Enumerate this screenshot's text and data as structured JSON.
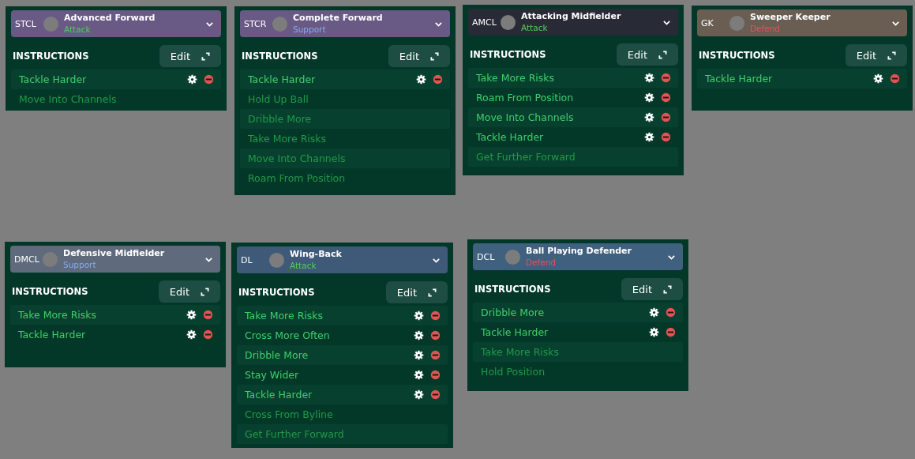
{
  "cards": [
    {
      "position": "STCL",
      "role": "Advanced Forward",
      "duty": {
        "text": "Attack",
        "kind": "attack"
      },
      "color": "#695985",
      "section_title": "INSTRUCTIONS",
      "edit_label": "Edit",
      "instructions": [
        {
          "label": "Tackle Harder",
          "active": true
        },
        {
          "label": "Move Into Channels",
          "active": false
        }
      ]
    },
    {
      "position": "STCR",
      "role": "Complete Forward",
      "duty": {
        "text": "Support",
        "kind": "support"
      },
      "color": "#695985",
      "section_title": "INSTRUCTIONS",
      "edit_label": "Edit",
      "instructions": [
        {
          "label": "Tackle Harder",
          "active": true
        },
        {
          "label": "Hold Up Ball",
          "active": false
        },
        {
          "label": "Dribble More",
          "active": false
        },
        {
          "label": "Take More Risks",
          "active": false
        },
        {
          "label": "Move Into Channels",
          "active": false
        },
        {
          "label": "Roam From Position",
          "active": false
        }
      ]
    },
    {
      "position": "AMCL",
      "role": "Attacking Midfielder",
      "duty": {
        "text": "Attack",
        "kind": "attack"
      },
      "color": "#282b35",
      "section_title": "INSTRUCTIONS",
      "edit_label": "Edit",
      "instructions": [
        {
          "label": "Take More Risks",
          "active": true
        },
        {
          "label": "Roam From Position",
          "active": true
        },
        {
          "label": "Move Into Channels",
          "active": true
        },
        {
          "label": "Tackle Harder",
          "active": true
        },
        {
          "label": "Get Further Forward",
          "active": false
        }
      ]
    },
    {
      "position": "GK",
      "role": "Sweeper Keeper",
      "duty": {
        "text": "Defend",
        "kind": "defend"
      },
      "color": "#6a5e53",
      "section_title": "INSTRUCTIONS",
      "edit_label": "Edit",
      "instructions": [
        {
          "label": "Tackle Harder",
          "active": true
        }
      ]
    },
    {
      "position": "DMCL",
      "role": "Defensive Midfielder",
      "duty": {
        "text": "Support",
        "kind": "support"
      },
      "color": "#5f6b7c",
      "section_title": "INSTRUCTIONS",
      "edit_label": "Edit",
      "instructions": [
        {
          "label": "Take More Risks",
          "active": true
        },
        {
          "label": "Tackle Harder",
          "active": true
        }
      ]
    },
    {
      "position": "DL",
      "role": "Wing-Back",
      "duty": {
        "text": "Attack",
        "kind": "attack"
      },
      "color": "#3f5a78",
      "section_title": "INSTRUCTIONS",
      "edit_label": "Edit",
      "instructions": [
        {
          "label": "Take More Risks",
          "active": true
        },
        {
          "label": "Cross More Often",
          "active": true
        },
        {
          "label": "Dribble More",
          "active": true
        },
        {
          "label": "Stay Wider",
          "active": true
        },
        {
          "label": "Tackle Harder",
          "active": true
        },
        {
          "label": "Cross From Byline",
          "active": false
        },
        {
          "label": "Get Further Forward",
          "active": false
        }
      ]
    },
    {
      "position": "DCL",
      "role": "Ball Playing Defender",
      "duty": {
        "text": "Defend",
        "kind": "defend"
      },
      "color": "#40607f",
      "section_title": "INSTRUCTIONS",
      "edit_label": "Edit",
      "instructions": [
        {
          "label": "Dribble More",
          "active": true
        },
        {
          "label": "Tackle Harder",
          "active": true
        },
        {
          "label": "Take More Risks",
          "active": false
        },
        {
          "label": "Hold Position",
          "active": false
        }
      ]
    }
  ]
}
